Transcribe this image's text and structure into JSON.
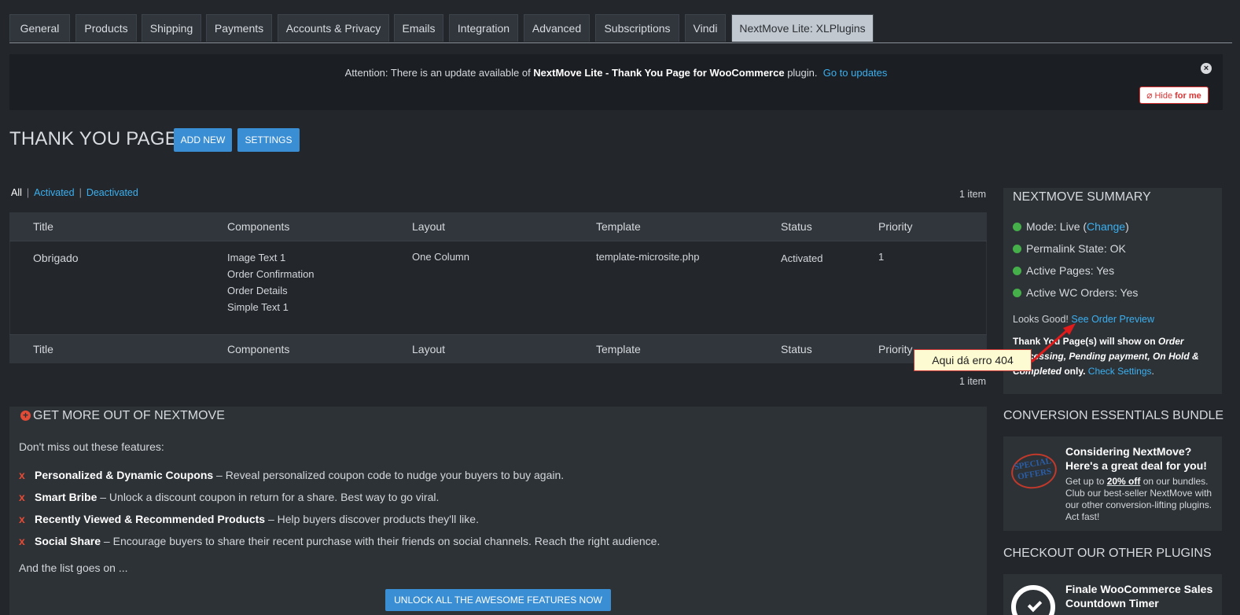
{
  "tabs": [
    "General",
    "Products",
    "Shipping",
    "Payments",
    "Accounts & Privacy",
    "Emails",
    "Integration",
    "Advanced",
    "Subscriptions",
    "Vindi",
    "NextMove Lite: XLPlugins"
  ],
  "notice": {
    "prefix": "Attention: There is an update available of ",
    "plugin_name": "NextMove Lite - Thank You Page for WooCommerce",
    "suffix": " plugin.",
    "link": "Go to updates",
    "close_icon": "×",
    "hide_prefix": "Hide",
    "hide_suffix": "for me"
  },
  "page": {
    "title": "THANK YOU PAGES",
    "add_new": "ADD NEW",
    "settings": "SETTINGS"
  },
  "filters": {
    "all": "All",
    "activated": "Activated",
    "deactivated": "Deactivated",
    "count_top": "1 item",
    "count_bottom": "1 item"
  },
  "table": {
    "columns": [
      "Title",
      "Components",
      "Layout",
      "Template",
      "Status",
      "Priority"
    ],
    "rows": [
      {
        "title": "Obrigado",
        "components": [
          "Image Text 1",
          "Order Confirmation",
          "Order Details",
          "Simple Text 1"
        ],
        "layout": "One Column",
        "template": "template-microsite.php",
        "status": "Activated",
        "priority": "1"
      }
    ]
  },
  "summary": {
    "title": "NEXTMOVE SUMMARY",
    "mode_label": "Mode: Live (",
    "mode_link": "Change",
    "mode_close": ")",
    "permalink": "Permalink State: OK",
    "active_pages": "Active Pages: Yes",
    "active_orders": "Active WC Orders: Yes",
    "looks_good": "Looks Good!",
    "preview_link": "See Order Preview",
    "note_a": "Thank You Page(s) will show on ",
    "note_b": "Order",
    "note_c": "Processing, Pending payment, On",
    "note_d": "Hold & Completed",
    "note_e": " only. ",
    "note_link": "Check Settings",
    "status_color": "#45b04a"
  },
  "callout": {
    "text": "Aqui dá erro 404"
  },
  "getmore": {
    "title": "GET MORE OUT OF NEXTMOVE",
    "subtitle": "Don't miss out these features:",
    "features": [
      {
        "name": "Personalized & Dynamic Coupons",
        "desc": " – Reveal personalized coupon code to nudge your buyers to buy again."
      },
      {
        "name": "Smart Bribe",
        "desc": " – Unlock a discount coupon in return for a share. Best way to go viral."
      },
      {
        "name": "Recently Viewed & Recommended Products",
        "desc": " – Help buyers discover products they'll like."
      },
      {
        "name": "Social Share",
        "desc": " – Encourage buyers to share their recent purchase with their friends on social channels. Reach the right audience."
      }
    ],
    "more": "And the list goes on ...",
    "unlock": "UNLOCK ALL THE AWESOME FEATURES NOW"
  },
  "bundle": {
    "heading": "CONVERSION ESSENTIALS BUNDLE",
    "badge": "SPECIAL OFFERS",
    "title": "Considering NextMove? Here's a great deal for you!",
    "text_a": "Get up to ",
    "text_b": "20% off",
    "text_c": " on our bundles. Club our best-seller NextMove with our other conversion-lifting plugins. Act fast!"
  },
  "plugins": {
    "heading": "CHECKOUT OUR OTHER PLUGINS",
    "item_title": "Finale WooCommerce Sales Countdown Timer"
  }
}
